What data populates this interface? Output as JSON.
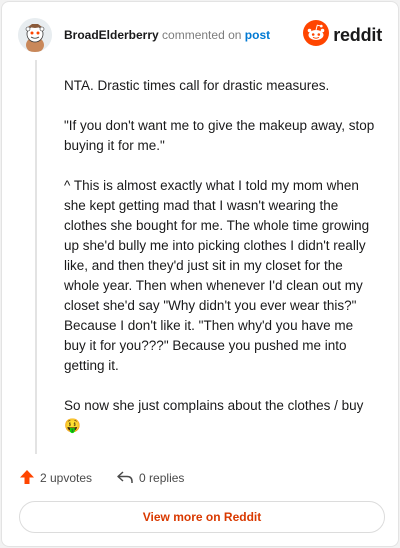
{
  "header": {
    "username": "BroadElderberry",
    "verb": "commented on",
    "target": "post",
    "brand": "reddit"
  },
  "comment": {
    "paragraphs": [
      "NTA. Drastic times call for drastic measures.",
      "\"If you don't want me to give the makeup away, stop buying it for me.\"",
      "^ This is almost exactly what I told my mom when she kept getting mad that I wasn't wearing the clothes she bought for me. The whole time growing up she'd bully me into picking clothes I didn't really like, and then they'd just sit in my closet for the whole year. Then when whenever I'd clean out my closet she'd say \"Why didn't you ever wear this?\" Because I don't like it. \"Then why'd you have me buy it for you???\" Because you pushed me into getting it.",
      "So now she just complains about the clothes / buy 🤑"
    ]
  },
  "footer": {
    "upvotes": "2 upvotes",
    "replies": "0 replies",
    "view_more": "View more on Reddit"
  },
  "colors": {
    "accent": "#ff4500",
    "link": "#0079d3",
    "view_more_text": "#d93900"
  },
  "icons": {
    "avatar": "snoo-avatar-icon",
    "brand": "reddit-logo-icon",
    "upvote": "upvote-arrow-icon",
    "reply": "reply-arrow-icon"
  }
}
